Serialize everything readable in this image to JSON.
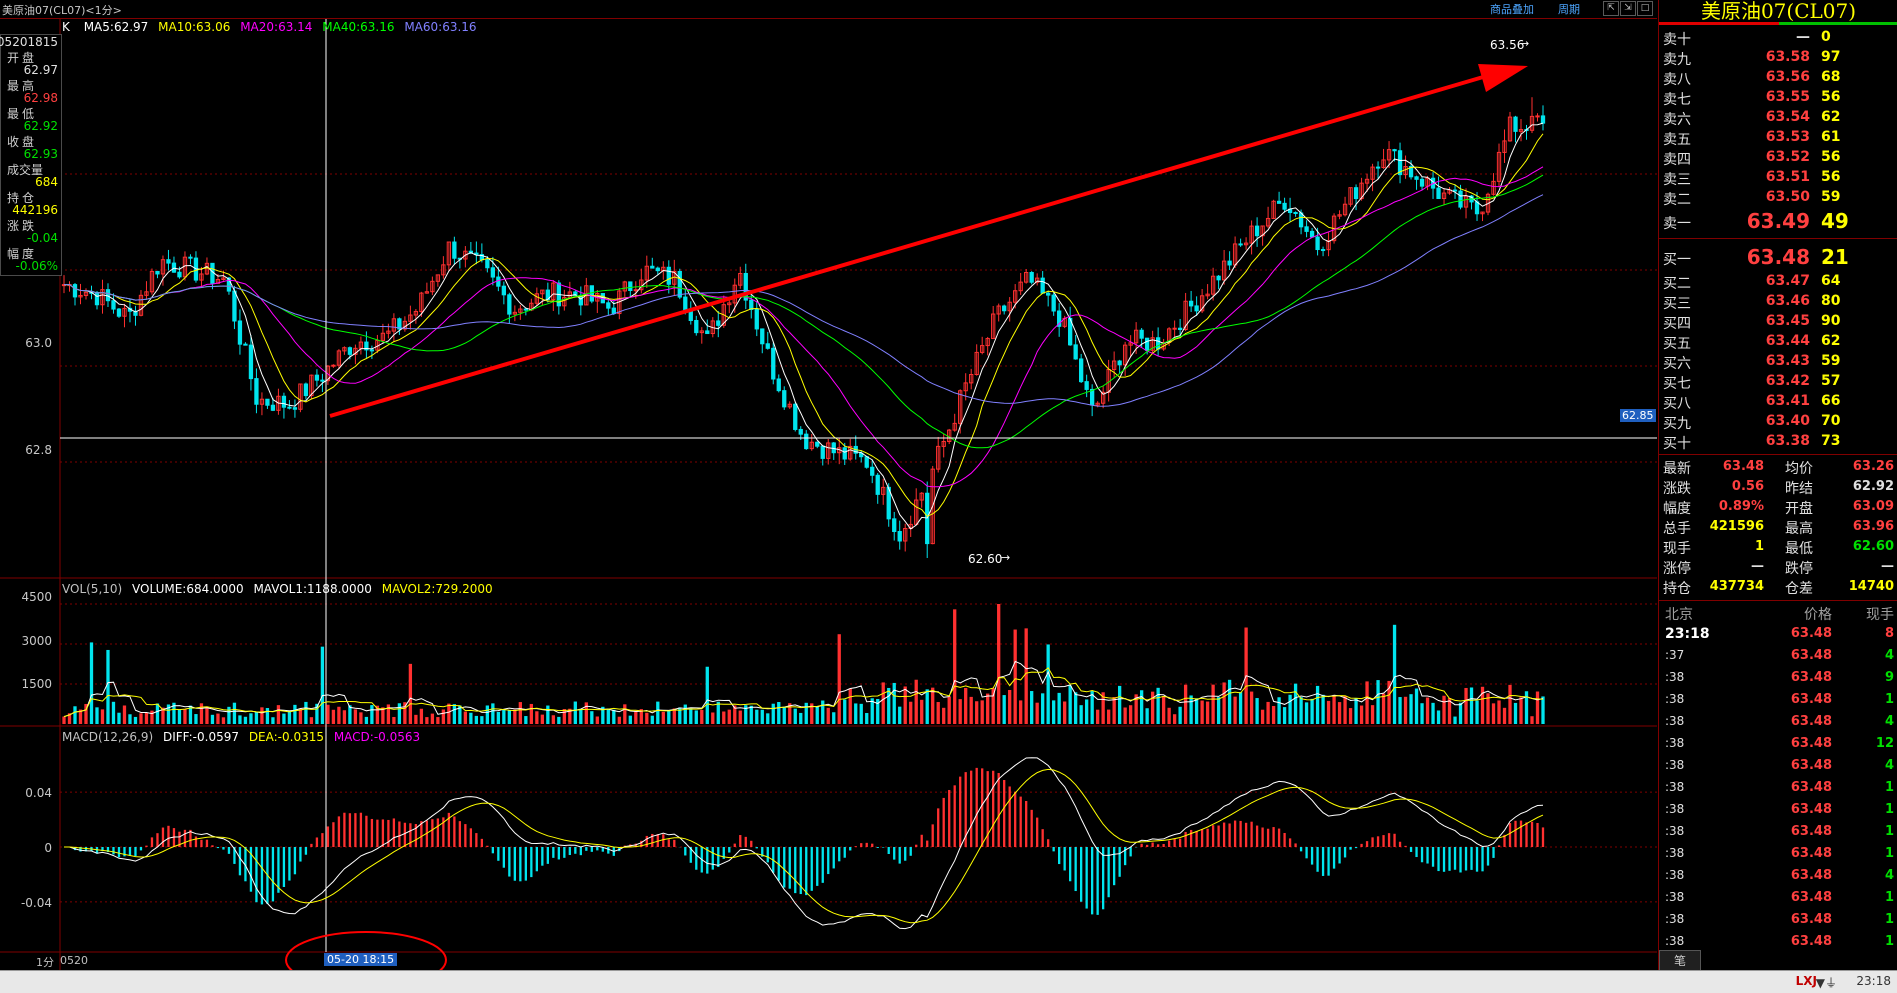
{
  "window": {
    "title": "美原油07(CL07)<1分>",
    "links": [
      "商品叠加",
      "周期"
    ],
    "buttons": [
      "⇱",
      "⇲",
      "□",
      "×"
    ]
  },
  "info_panel": {
    "date": "05201815",
    "rows": [
      {
        "label": "开盘",
        "value": "62.97",
        "color": "#e0e0e0"
      },
      {
        "label": "最高",
        "value": "62.98",
        "color": "#ff4040"
      },
      {
        "label": "最低",
        "value": "62.92",
        "color": "#00e000"
      },
      {
        "label": "收盘",
        "value": "62.93",
        "color": "#00e000"
      },
      {
        "label": "成交量",
        "value": "684",
        "color": "#ffff00"
      },
      {
        "label": "持仓",
        "value": "442196",
        "color": "#ffff00"
      },
      {
        "label": "涨跌",
        "value": "-0.04",
        "color": "#00e000"
      },
      {
        "label": "幅度",
        "value": "-0.06%",
        "color": "#00e000"
      }
    ]
  },
  "ma_legend": [
    {
      "text": "K",
      "color": "#ffffff"
    },
    {
      "text": "MA5:62.97",
      "color": "#ffffff"
    },
    {
      "text": "MA10:63.06",
      "color": "#ffff00"
    },
    {
      "text": "MA20:63.14",
      "color": "#ff00ff"
    },
    {
      "text": "MA40:63.16",
      "color": "#00ff00"
    },
    {
      "text": "MA60:63.16",
      "color": "#8080ff"
    }
  ],
  "vol_legend": [
    {
      "text": "VOL(5,10)",
      "color": "#c0c0c0"
    },
    {
      "text": "VOLUME:684.0000",
      "color": "#ffffff"
    },
    {
      "text": "MAVOL1:1188.0000",
      "color": "#ffffff"
    },
    {
      "text": "MAVOL2:729.2000",
      "color": "#ffff00"
    }
  ],
  "macd_legend": [
    {
      "text": "MACD(12,26,9)",
      "color": "#c0c0c0"
    },
    {
      "text": "DIFF:-0.0597",
      "color": "#ffffff"
    },
    {
      "text": "DEA:-0.0315",
      "color": "#ffff00"
    },
    {
      "text": "MACD:-0.0563",
      "color": "#ff00ff"
    }
  ],
  "price_axis": {
    "labels": [
      "63.0",
      "62.8"
    ],
    "current_marker": "62.85",
    "high_label": "63.56",
    "low_label": "62.60"
  },
  "vol_axis": {
    "labels": [
      "4500",
      "3000",
      "1500"
    ]
  },
  "macd_axis": {
    "labels": [
      "0.04",
      "0",
      "-0.04"
    ]
  },
  "bottom_axis": {
    "period": "1分",
    "date": "0520",
    "cursor_time": "05-20 18:15"
  },
  "colors": {
    "up": "#ff3030",
    "down": "#00e5ee",
    "grid": "#800000",
    "accent": "#ff0000"
  },
  "chart_data": {
    "type": "candlestick",
    "period": "1分",
    "price_axis_ticks": [
      63.0,
      62.8
    ],
    "ylim": [
      62.6,
      63.65
    ],
    "highest": 63.56,
    "lowest": 62.6,
    "cursor": {
      "time": "05-20 18:15",
      "price": 62.85
    },
    "price_path_approx": [
      63.17,
      63.15,
      63.1,
      63.22,
      63.2,
      63.18,
      62.93,
      62.92,
      62.98,
      63.05,
      63.06,
      63.12,
      63.25,
      63.2,
      63.12,
      63.15,
      63.15,
      63.12,
      63.2,
      63.18,
      63.05,
      63.2,
      63.0,
      62.85,
      62.82,
      62.8,
      62.65,
      62.78,
      62.95,
      63.1,
      63.18,
      63.1,
      62.9,
      63.05,
      63.05,
      63.12,
      63.2,
      63.28,
      63.35,
      63.25,
      63.35,
      63.45,
      63.4,
      63.35,
      63.32,
      63.5,
      63.5
    ],
    "volume_axis_ticks": [
      4500,
      3000,
      1500
    ],
    "macd_axis_ticks": [
      0.04,
      0,
      -0.04
    ],
    "indicators": {
      "MA5": 62.97,
      "MA10": 63.06,
      "MA20": 63.14,
      "MA40": 63.16,
      "MA60": 63.16,
      "VOLUME": 684.0,
      "MAVOL1": 1188.0,
      "MAVOL2": 729.2,
      "DIFF": -0.0597,
      "DEA": -0.0315,
      "MACD": -0.0563
    }
  },
  "right_panel": {
    "title": "美原油07(CL07)",
    "asks": [
      {
        "label": "卖十",
        "price": "—",
        "vol": "0"
      },
      {
        "label": "卖九",
        "price": "63.58",
        "vol": "97"
      },
      {
        "label": "卖八",
        "price": "63.56",
        "vol": "68"
      },
      {
        "label": "卖七",
        "price": "63.55",
        "vol": "56"
      },
      {
        "label": "卖六",
        "price": "63.54",
        "vol": "62"
      },
      {
        "label": "卖五",
        "price": "63.53",
        "vol": "61"
      },
      {
        "label": "卖四",
        "price": "63.52",
        "vol": "56"
      },
      {
        "label": "卖三",
        "price": "63.51",
        "vol": "56"
      },
      {
        "label": "卖二",
        "price": "63.50",
        "vol": "59"
      },
      {
        "label": "卖一",
        "price": "63.49",
        "vol": "49"
      }
    ],
    "bids": [
      {
        "label": "买一",
        "price": "63.48",
        "vol": "21"
      },
      {
        "label": "买二",
        "price": "63.47",
        "vol": "64"
      },
      {
        "label": "买三",
        "price": "63.46",
        "vol": "80"
      },
      {
        "label": "买四",
        "price": "63.45",
        "vol": "90"
      },
      {
        "label": "买五",
        "price": "63.44",
        "vol": "62"
      },
      {
        "label": "买六",
        "price": "63.43",
        "vol": "59"
      },
      {
        "label": "买七",
        "price": "63.42",
        "vol": "57"
      },
      {
        "label": "买八",
        "price": "63.41",
        "vol": "66"
      },
      {
        "label": "买九",
        "price": "63.40",
        "vol": "70"
      },
      {
        "label": "买十",
        "price": "63.38",
        "vol": "73"
      }
    ],
    "stats": [
      {
        "l1": "最新",
        "v1": "63.48",
        "c1": "#ff4040",
        "l2": "均价",
        "v2": "63.26",
        "c2": "#ff4040"
      },
      {
        "l1": "涨跌",
        "v1": "0.56",
        "c1": "#ff4040",
        "l2": "昨结",
        "v2": "62.92",
        "c2": "#e0e0e0"
      },
      {
        "l1": "幅度",
        "v1": "0.89%",
        "c1": "#ff4040",
        "l2": "开盘",
        "v2": "63.09",
        "c2": "#ff4040"
      },
      {
        "l1": "总手",
        "v1": "421596",
        "c1": "#ffff00",
        "l2": "最高",
        "v2": "63.96",
        "c2": "#ff4040"
      },
      {
        "l1": "现手",
        "v1": "1",
        "c1": "#ffff00",
        "l2": "最低",
        "v2": "62.60",
        "c2": "#00e000"
      },
      {
        "l1": "涨停",
        "v1": "—",
        "c1": "#e0e0e0",
        "l2": "跌停",
        "v2": "—",
        "c2": "#e0e0e0"
      },
      {
        "l1": "持仓",
        "v1": "437734",
        "c1": "#ffff00",
        "l2": "仓差",
        "v2": "14740",
        "c2": "#ffff00"
      }
    ],
    "ticks_header": {
      "time": "北京",
      "price": "价格",
      "vol": "现手"
    },
    "ticks": [
      {
        "time": "23:18",
        "price": "63.48",
        "vol": "8",
        "vc": "#ff4040"
      },
      {
        "time": ":37",
        "price": "63.48",
        "vol": "4",
        "vc": "#00e000"
      },
      {
        "time": ":38",
        "price": "63.48",
        "vol": "9",
        "vc": "#00e000"
      },
      {
        "time": ":38",
        "price": "63.48",
        "vol": "1",
        "vc": "#00e000"
      },
      {
        "time": ":38",
        "price": "63.48",
        "vol": "4",
        "vc": "#00e000"
      },
      {
        "time": ":38",
        "price": "63.48",
        "vol": "12",
        "vc": "#00e000"
      },
      {
        "time": ":38",
        "price": "63.48",
        "vol": "4",
        "vc": "#00e000"
      },
      {
        "time": ":38",
        "price": "63.48",
        "vol": "1",
        "vc": "#00e000"
      },
      {
        "time": ":38",
        "price": "63.48",
        "vol": "1",
        "vc": "#00e000"
      },
      {
        "time": ":38",
        "price": "63.48",
        "vol": "1",
        "vc": "#00e000"
      },
      {
        "time": ":38",
        "price": "63.48",
        "vol": "1",
        "vc": "#00e000"
      },
      {
        "time": ":38",
        "price": "63.48",
        "vol": "4",
        "vc": "#00e000"
      },
      {
        "time": ":38",
        "price": "63.48",
        "vol": "1",
        "vc": "#00e000"
      },
      {
        "time": ":38",
        "price": "63.48",
        "vol": "1",
        "vc": "#00e000"
      },
      {
        "time": ":38",
        "price": "63.48",
        "vol": "1",
        "vc": "#00e000"
      }
    ],
    "footer_tab": "笔"
  },
  "statusbar": {
    "right": "LXJ",
    "time": "23:18"
  }
}
